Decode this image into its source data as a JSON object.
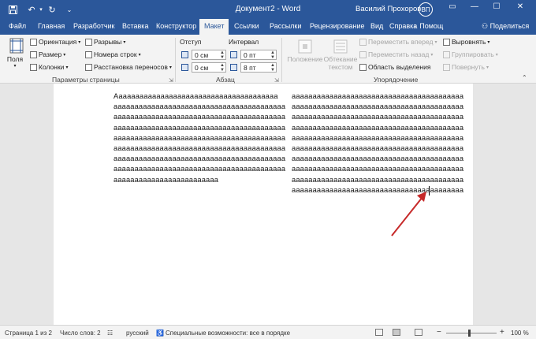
{
  "window": {
    "title": "Документ2 - Word",
    "user": "Василий Прохоров",
    "avatar_initials": "ВП"
  },
  "tabs": [
    "Файл",
    "Главная",
    "Разработчик",
    "Вставка",
    "Конструктор",
    "Макет",
    "Ссылки",
    "Рассылки",
    "Рецензирование",
    "Вид",
    "Справка"
  ],
  "active_tab": "Макет",
  "tellme": "Помощ",
  "share": "Поделиться",
  "ribbon": {
    "margins": "Поля",
    "orientation": "Ориентация",
    "size": "Размер",
    "columns": "Колонки",
    "breaks": "Разрывы",
    "line_numbers": "Номера строк",
    "hyphenation": "Расстановка переносов",
    "page_setup_label": "Параметры страницы",
    "indent_label": "Отступ",
    "spacing_label": "Интервал",
    "indent_left": "0 см",
    "indent_right": "0 см",
    "spacing_before": "0 пт",
    "spacing_after": "8 пт",
    "paragraph_label": "Абзац",
    "position": "Положение",
    "wrap_text_1": "Обтекание",
    "wrap_text_2": "текстом",
    "bring_forward": "Переместить вперед",
    "send_backward": "Переместить назад",
    "selection_pane": "Область выделения",
    "align": "Выровнять",
    "group": "Группировать",
    "rotate": "Повернуть",
    "arrange_label": "Упорядочение"
  },
  "document": {
    "left_column": [
      "Ааааааааааааааааааааааааааааааааааааааа",
      "ааааааааааааааааааааааааааааааааааааааааа",
      "ааааааааааааааааааааааааааааааааааааааааа",
      "ааааааааааааааааааааааааааааааааааааааааа",
      "ааааааааааааааааааааааааааааааааааааааааа",
      "ааааааааааааааааааааааааааааааааааааааааа",
      "ааааааааааааааааааааааааааааааааааааааааа",
      "ааааааааааааааааааааааааааааааааааааааааа",
      "ааааааааааааааааааааааааа"
    ],
    "right_column": [
      "ааааааааааааааааааааааааааааааааааааааааа",
      "ааааааааааааааааааааааааааааааааааааааааа",
      "ааааааааааааааааааааааааааааааааааааааааа",
      "ааааааааааааааааааааааааааааааааааааааааа",
      "ааааааааааааааааааааааааааааааааааааааааа",
      "ааааааааааааааааааааааааааааааааааааааааа",
      "ааааааааааааааааааааааааааааааааааааааааа",
      "ааааааааааааааааааааааааааааааааааааааааа",
      "ааааааааааааааааааааааааааааааааааааааааа",
      "ааааааааааааааааааааааааааааааааааааааааа"
    ]
  },
  "status": {
    "page": "Страница 1 из 2",
    "words": "Число слов: 2",
    "language": "русский",
    "accessibility": "Специальные возможности: все в порядке",
    "zoom": "100 %"
  },
  "colors": {
    "word_blue": "#2b579a",
    "annotation_arrow": "#c62828"
  }
}
